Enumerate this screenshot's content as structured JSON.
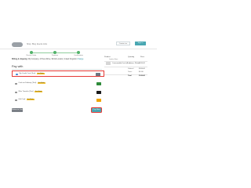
{
  "nav": {
    "links": [
      "Shop",
      "Blog",
      "Events",
      "Jobs"
    ],
    "contact_label": "Contact us",
    "signin_label": "Sign in"
  },
  "progress": {
    "steps": [
      "Review Order",
      "Payment",
      "Confirmation"
    ],
    "current_step": 2
  },
  "billing": {
    "label": "Billing & shipping:",
    "address": "My Company, 4 Privet Drive, 93411 London, United Kingdom",
    "change_label": "Change"
  },
  "payment": {
    "title": "Pay with",
    "methods": [
      {
        "label": "My Credit Card (Test)",
        "tag": "Test Mode",
        "icon": "credit-card-icon",
        "selected": true
      },
      {
        "label": "Cash on Delivery (Test)",
        "tag": "Test Mode",
        "icon": "cash-icon",
        "selected": false
      },
      {
        "label": "Wire Transfer (Test)",
        "tag": "Test Mode",
        "icon": "bank-icon",
        "selected": false
      },
      {
        "label": "Gift Card",
        "tag": "Test Mode",
        "icon": "gift-card-icon",
        "selected": false
      }
    ],
    "return_label": "Return to Cart",
    "pay_label": "Pay Now"
  },
  "summary": {
    "headers": [
      "Product",
      "Quantity",
      "Price"
    ],
    "location_title": "London Store",
    "product": {
      "name": "Customizable Desk (Aluminium, White)",
      "qty": "1",
      "price": "$ 800.40"
    },
    "rows": [
      {
        "label": "Subtotal",
        "value": "$ 800.40"
      },
      {
        "label": "Taxes",
        "value": "$ 0.00"
      },
      {
        "label": "Total",
        "value": "$ 800.40"
      }
    ]
  },
  "colors": {
    "accent": "#49a7b2",
    "success": "#52b36a",
    "highlight": "#e53935",
    "tag": "#f2c233"
  }
}
